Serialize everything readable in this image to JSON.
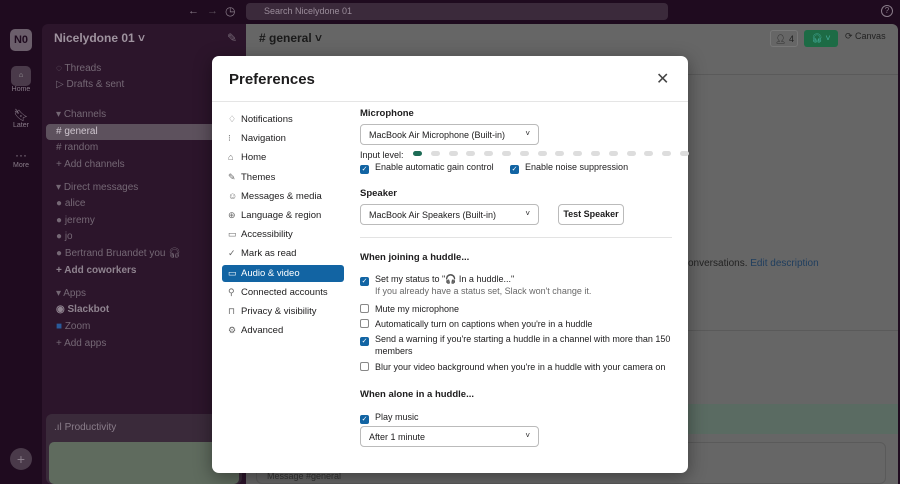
{
  "topbar": {
    "search_placeholder": "Search Nicelydone 01",
    "help": "?"
  },
  "rail": {
    "workspace": "N0",
    "items": [
      {
        "label": "Home"
      },
      {
        "label": "Later"
      },
      {
        "label": "More"
      }
    ]
  },
  "sidebar": {
    "workspace_name": "Nicelydone 01 ˅",
    "threads": "Threads",
    "drafts": "Drafts & sent",
    "channels_header": "Channels",
    "channels": [
      "general",
      "random"
    ],
    "add_channels": "Add channels",
    "dm_header": "Direct messages",
    "dms": [
      "alice",
      "jeremy",
      "jo",
      "Bertrand Bruandet  you"
    ],
    "add_coworkers": "Add coworkers",
    "apps_header": "Apps",
    "apps": [
      "Slackbot",
      "Zoom"
    ],
    "add_apps": "Add apps",
    "productivity": "Productivity"
  },
  "main": {
    "channel": "# general ˅",
    "members": "4",
    "canvas": "Canvas",
    "desc_text": "onversations.",
    "edit_description": "Edit description",
    "composer_placeholder": "Message #general"
  },
  "modal": {
    "title": "Preferences",
    "nav": [
      "Notifications",
      "Navigation",
      "Home",
      "Themes",
      "Messages & media",
      "Language & region",
      "Accessibility",
      "Mark as read",
      "Audio & video",
      "Connected accounts",
      "Privacy & visibility",
      "Advanced"
    ],
    "nav_icons": [
      "bell-icon",
      "navigation-icon",
      "home-icon",
      "brush-icon",
      "message-icon",
      "globe-icon",
      "accessibility-icon",
      "check-circle-icon",
      "video-icon",
      "link-icon",
      "lock-icon",
      "gear-icon"
    ],
    "microphone_label": "Microphone",
    "microphone_value": "MacBook Air Microphone (Built-in)",
    "input_level_label": "Input level:",
    "input_level_fraction": 0.07,
    "gain": "Enable automatic gain control",
    "noise": "Enable noise suppression",
    "speaker_label": "Speaker",
    "speaker_value": "MacBook Air Speakers (Built-in)",
    "test_speaker": "Test Speaker",
    "joining_header": "When joining a huddle...",
    "joining": [
      {
        "label": "Set my status to \"🎧 In a huddle...\"",
        "checked": true
      },
      {
        "label": "Mute my microphone",
        "checked": false
      },
      {
        "label": "Automatically turn on captions when you're in a huddle",
        "checked": false
      },
      {
        "label": "Send a warning if you're starting a huddle in a channel with more than 150",
        "checked": true
      },
      {
        "label": "Blur your video background when you're in a huddle with your camera on",
        "checked": false
      }
    ],
    "status_hint": "If you already have a status set, Slack won't change it.",
    "members_wrap": "members",
    "alone_header": "When alone in a huddle...",
    "play_music": "Play music",
    "after_value": "After 1 minute"
  },
  "colors": {
    "accent": "#1264a3",
    "huddle_green": "#1d6b45"
  }
}
